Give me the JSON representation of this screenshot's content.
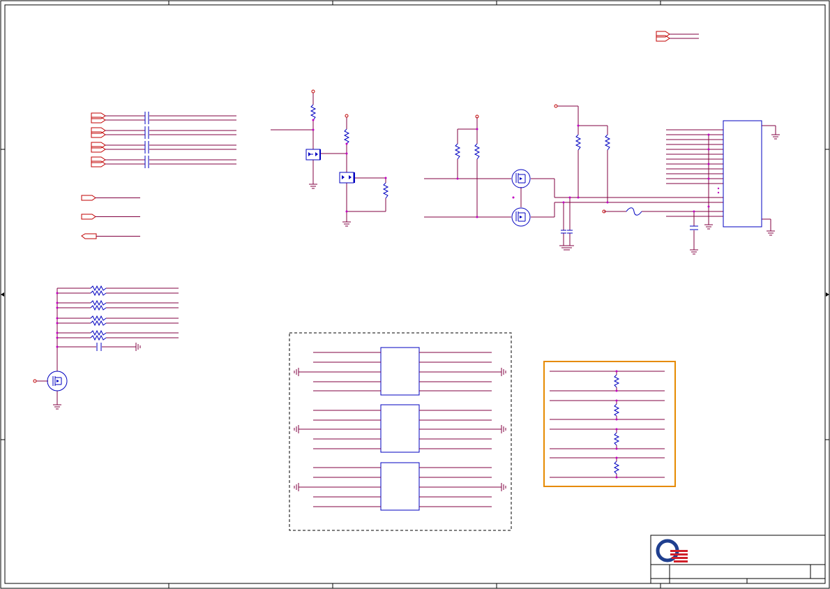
{
  "sheet": {
    "background": "#ffffff",
    "border_color": "#000000",
    "wire_color": "#800040",
    "component_color": "#0000c0",
    "port_color": "#c00000",
    "junction_color": "#c000c0",
    "highlight_box_color": "#e68a00",
    "logo_colors": [
      "#1f3f8f",
      "#d0202a"
    ]
  },
  "blocks": [
    "zone-markers",
    "offpage-connector-top-right",
    "coupling-capacitor-bank",
    "single-ports",
    "mosfet-level-shifter-left",
    "mosfet-pair-right",
    "connector-header-right",
    "pullup-resistor-network",
    "dashed-module-block",
    "orange-resistor-block",
    "title-block"
  ]
}
